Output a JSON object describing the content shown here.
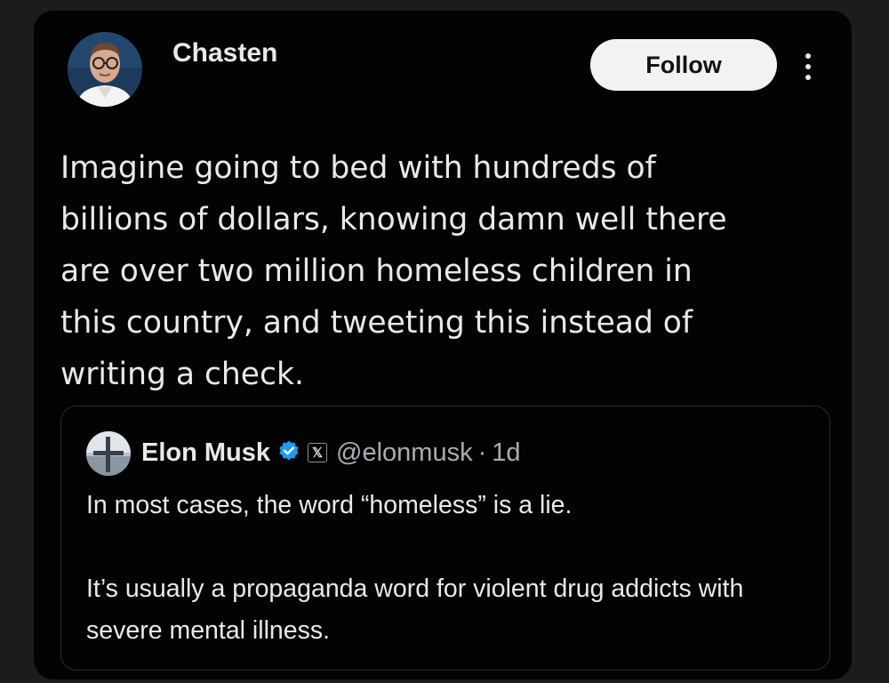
{
  "post": {
    "author_name": "Chasten",
    "follow_label": "Follow",
    "more_icon": "more-vertical-icon",
    "text": "Imagine going to bed with hundreds of\nbillions of dollars, knowing damn well there\nare over two million homeless children in\nthis country, and tweeting this instead of\nwriting a check."
  },
  "quoted": {
    "name": "Elon Musk",
    "verified_icon": "verified-badge-icon",
    "badge_icon": "x-logo-icon",
    "badge_glyph": "𝕏",
    "handle": "@elonmusk",
    "separator": "·",
    "time": "1d",
    "paragraphs": [
      "In most cases, the word “homeless” is a lie.",
      "It’s usually a propaganda word for violent drug addicts with severe mental illness."
    ]
  },
  "colors": {
    "background": "#030303",
    "text": "#e7e9ea",
    "muted": "#a8adb2",
    "verified": "#1d9bf0",
    "follow_bg": "#f2f2f2"
  }
}
